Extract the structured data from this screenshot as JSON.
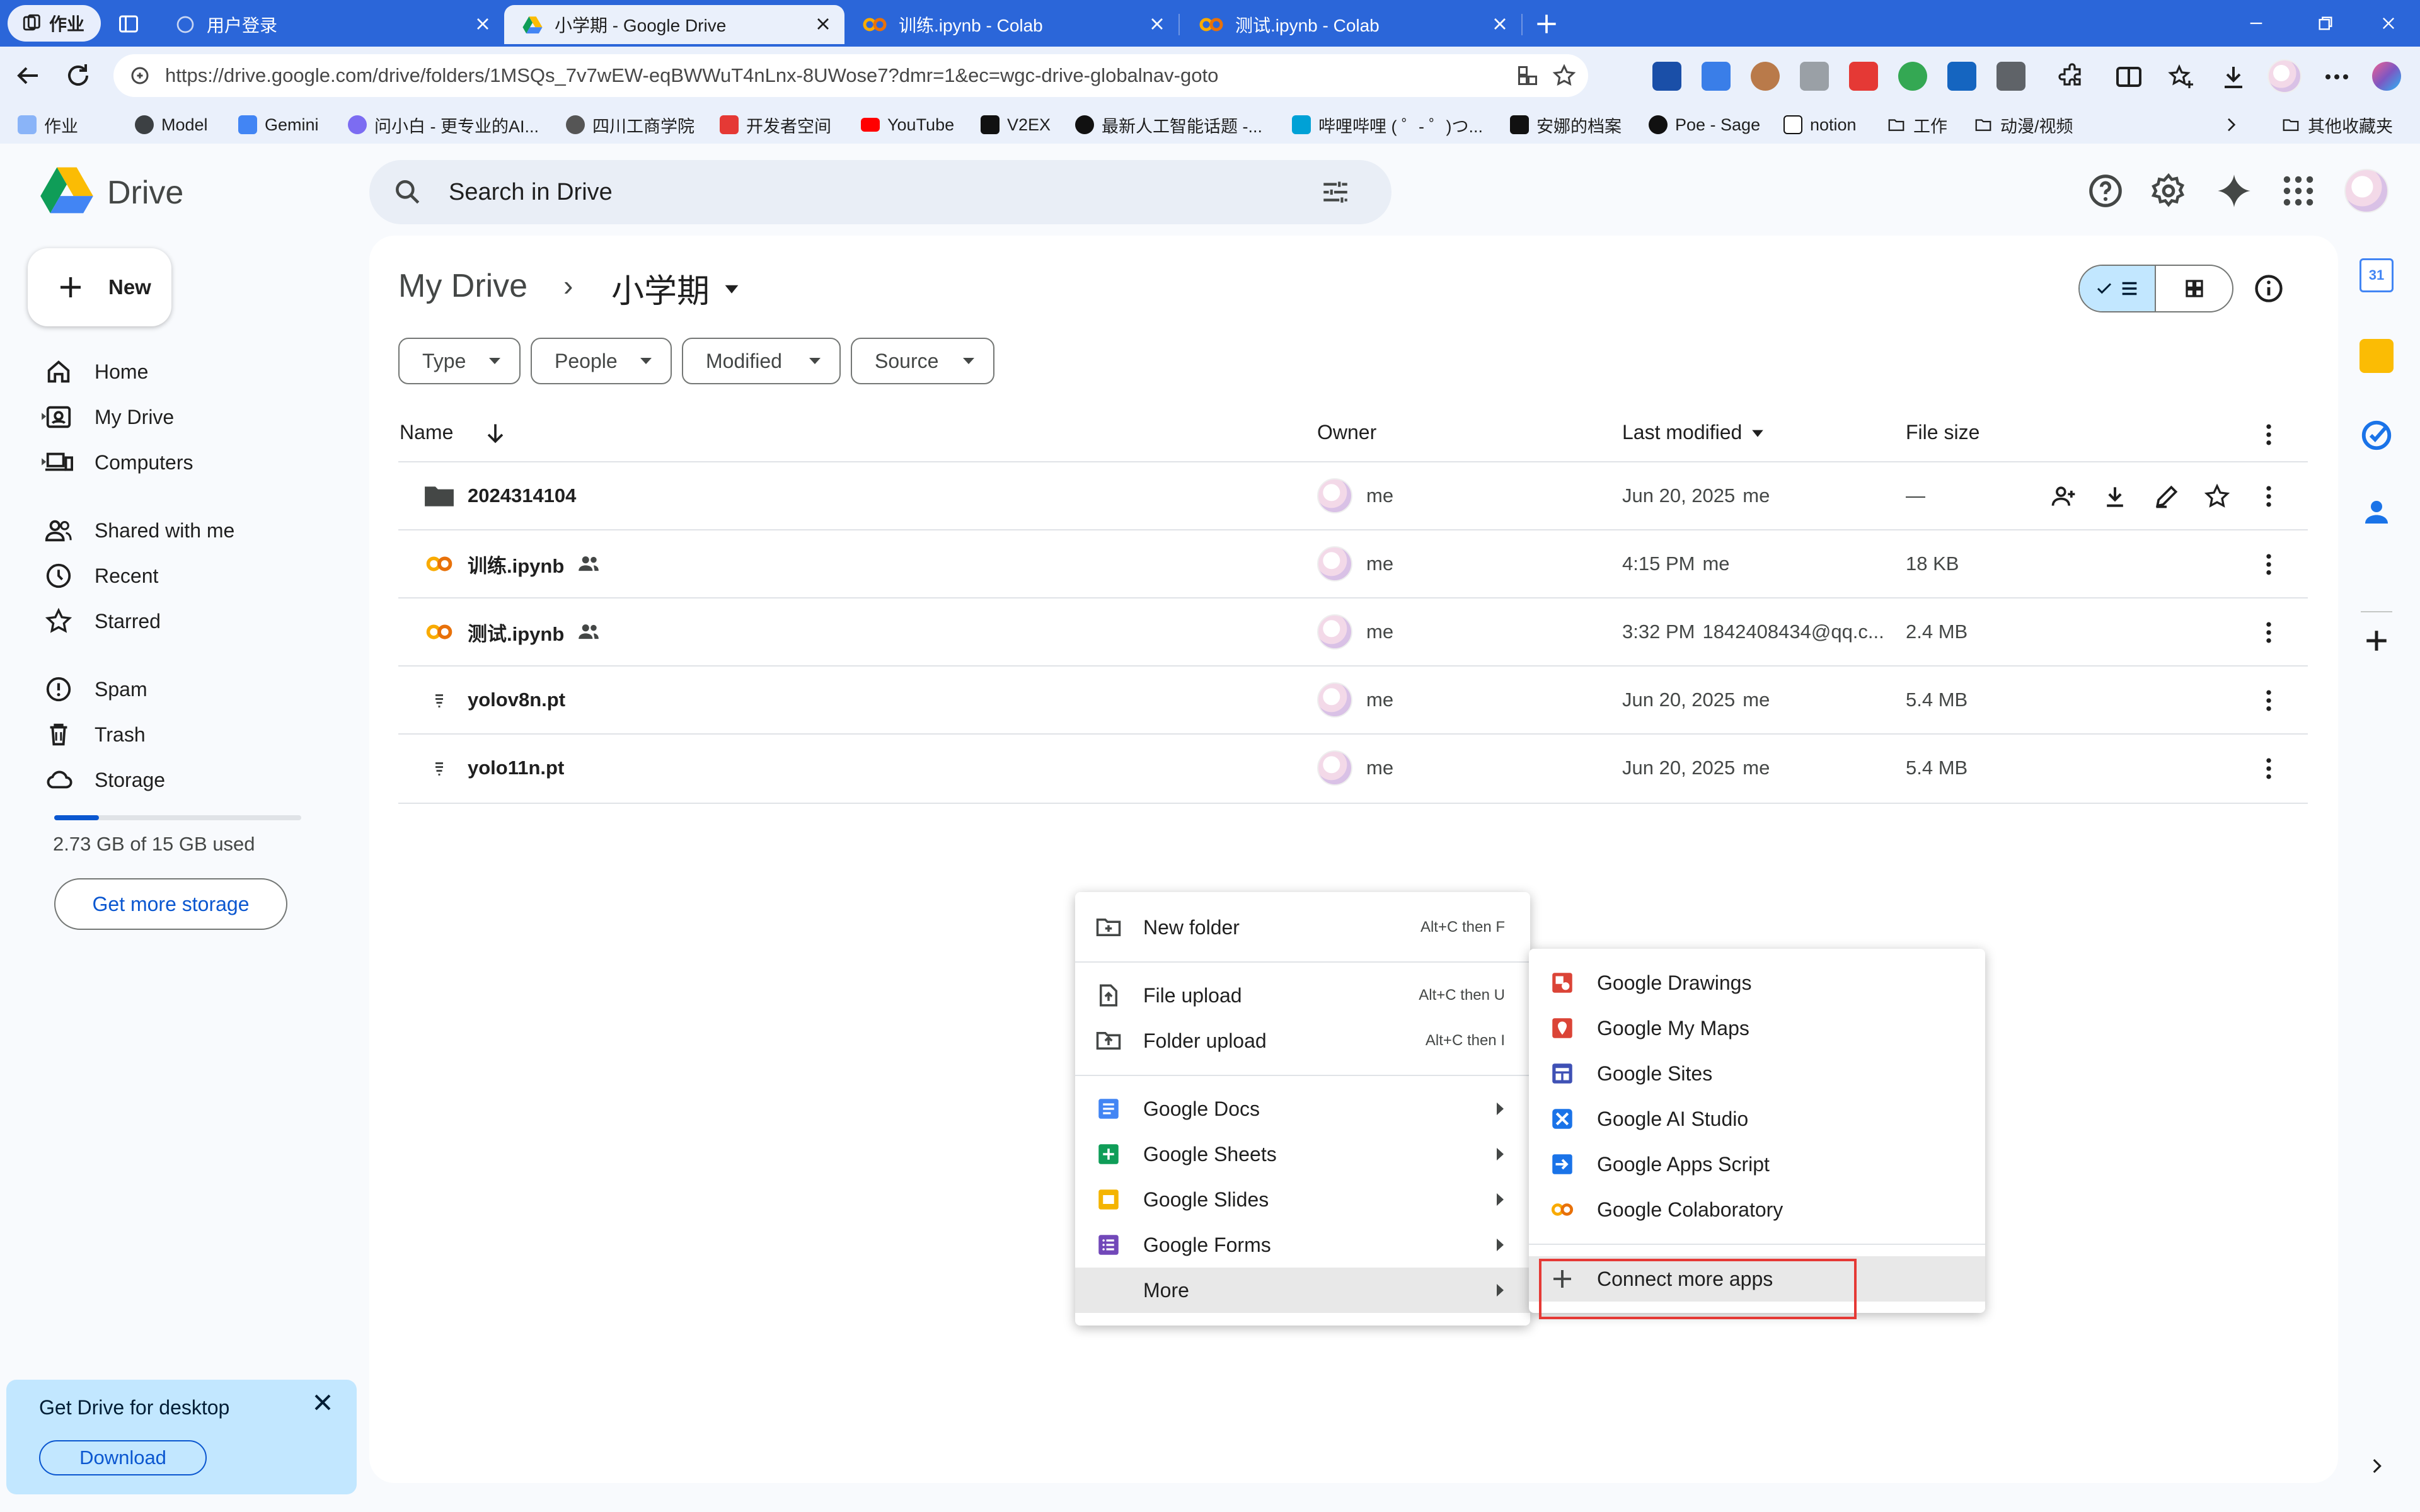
{
  "browser": {
    "workspace_label": "作业",
    "tabs": [
      {
        "title": "用户登录",
        "active": false
      },
      {
        "title": "小学期 - Google Drive",
        "active": true
      },
      {
        "title": "训练.ipynb - Colab",
        "active": false
      },
      {
        "title": "测试.ipynb - Colab",
        "active": false
      }
    ],
    "url": "https://drive.google.com/drive/folders/1MSQs_7v7wEW-eqBWWuT4nLnx-8UWose7?dmr=1&ec=wgc-drive-globalnav-goto",
    "bookmarks": [
      "作业",
      "Model",
      "Gemini",
      "问小白 - 更专业的AI...",
      "四川工商学院",
      "开发者空间",
      "YouTube",
      "V2EX",
      "最新人工智能话题 -...",
      "哔哩哔哩 ( ゜- ゜)つ...",
      "安娜的档案",
      "Poe - Sage",
      "notion",
      "工作",
      "动漫/视频"
    ],
    "other_bookmarks": "其他收藏夹"
  },
  "drive": {
    "logo_text": "Drive",
    "search_placeholder": "Search in Drive",
    "new_button": "New",
    "nav": {
      "home": "Home",
      "my_drive": "My Drive",
      "computers": "Computers",
      "shared": "Shared with me",
      "recent": "Recent",
      "starred": "Starred",
      "spam": "Spam",
      "trash": "Trash",
      "storage": "Storage"
    },
    "storage_text": "2.73 GB of 15 GB used",
    "storage_used_fraction": 0.18,
    "get_storage": "Get more storage",
    "promo": {
      "title": "Get Drive for desktop",
      "download": "Download"
    },
    "breadcrumb": {
      "root": "My Drive",
      "separator": "›",
      "current": "小学期"
    },
    "filters": [
      "Type",
      "People",
      "Modified",
      "Source"
    ],
    "columns": {
      "name": "Name",
      "owner": "Owner",
      "modified": "Last modified",
      "size": "File size"
    },
    "files": [
      {
        "name": "2024314104",
        "kind": "folder",
        "shared": false,
        "owner": "me",
        "modified": "Jun 20, 2025",
        "modified_by": "me",
        "size": "—"
      },
      {
        "name": "训练.ipynb",
        "kind": "colab",
        "shared": true,
        "owner": "me",
        "modified": "4:15 PM",
        "modified_by": "me",
        "size": "18 KB"
      },
      {
        "name": "测试.ipynb",
        "kind": "colab",
        "shared": true,
        "owner": "me",
        "modified": "3:32 PM",
        "modified_by": "1842408434@qq.c...",
        "size": "2.4 MB"
      },
      {
        "name": "yolov8n.pt",
        "kind": "file",
        "shared": false,
        "owner": "me",
        "modified": "Jun 20, 2025",
        "modified_by": "me",
        "size": "5.4 MB"
      },
      {
        "name": "yolo11n.pt",
        "kind": "file",
        "shared": false,
        "owner": "me",
        "modified": "Jun 20, 2025",
        "modified_by": "me",
        "size": "5.4 MB"
      }
    ]
  },
  "context_menu": {
    "new_folder": {
      "label": "New folder",
      "shortcut": "Alt+C then F"
    },
    "file_upload": {
      "label": "File upload",
      "shortcut": "Alt+C then U"
    },
    "folder_upload": {
      "label": "Folder upload",
      "shortcut": "Alt+C then I"
    },
    "docs": "Google Docs",
    "sheets": "Google Sheets",
    "slides": "Google Slides",
    "forms": "Google Forms",
    "more": "More"
  },
  "more_menu": {
    "drawings": "Google Drawings",
    "my_maps": "Google My Maps",
    "sites": "Google Sites",
    "ai_studio": "Google AI Studio",
    "apps_script": "Google Apps Script",
    "colaboratory": "Google Colaboratory",
    "connect": "Connect more apps"
  },
  "colors": {
    "accent": "#0b57d0",
    "chrome_blue": "#2b66d9",
    "highlight_box": "#e53935",
    "selected_view": "#c2e7ff"
  }
}
